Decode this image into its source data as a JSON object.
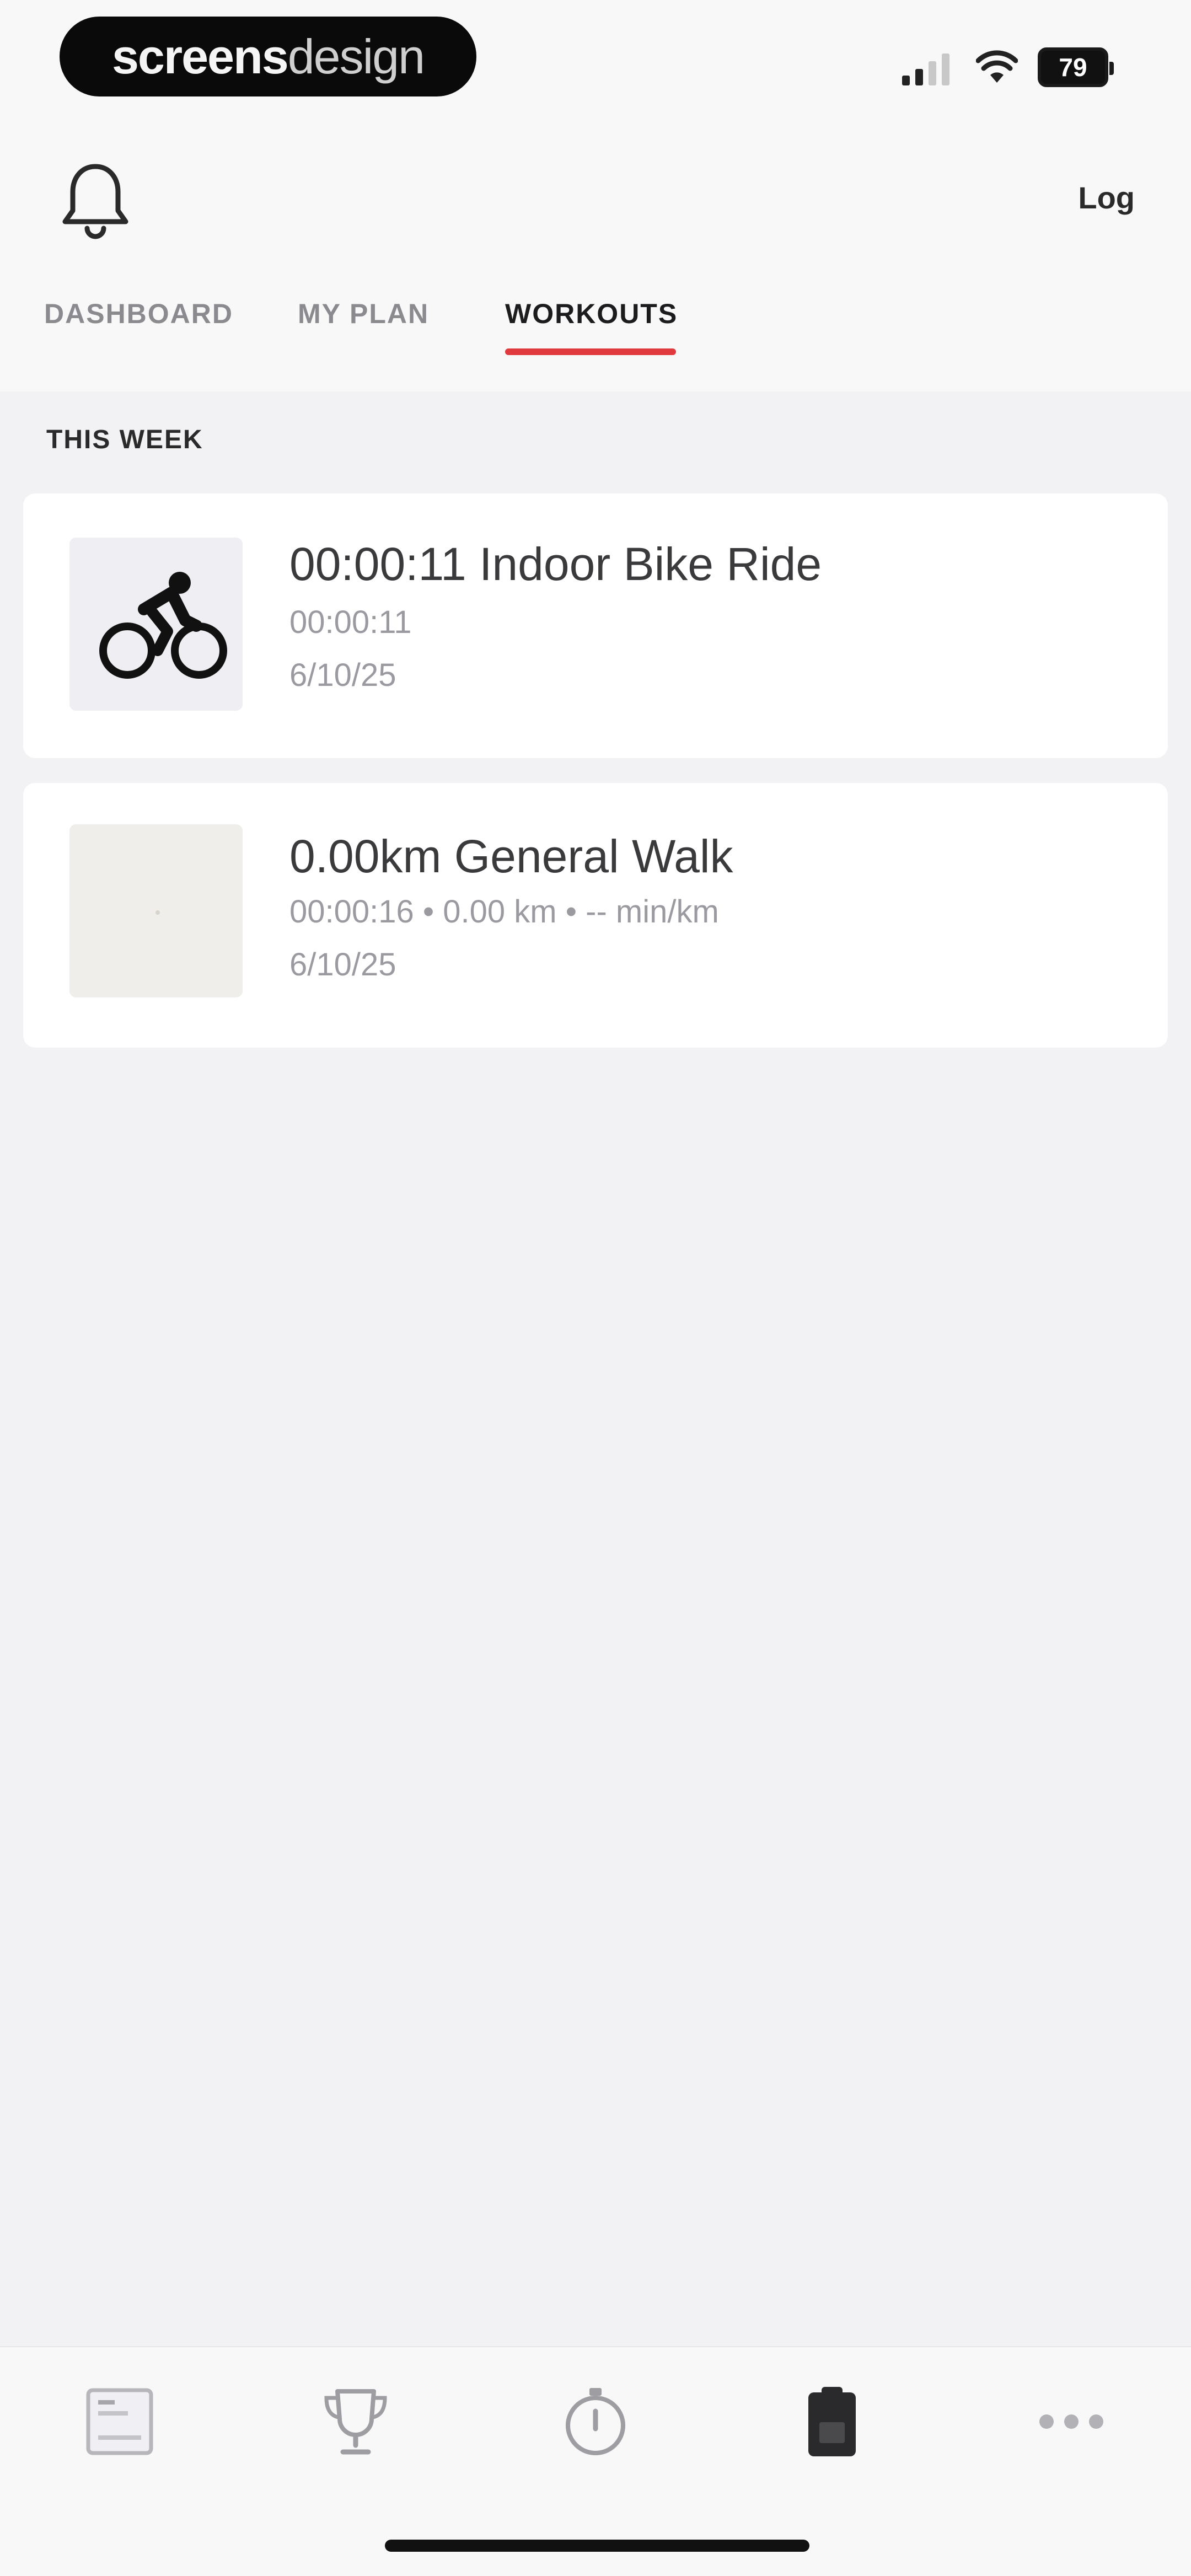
{
  "status_bar": {
    "brand_bold": "screens",
    "brand_light": "design",
    "battery": "79"
  },
  "header": {
    "log_label": "Log"
  },
  "tabs": [
    {
      "label": "DASHBOARD",
      "active": false
    },
    {
      "label": "MY PLAN",
      "active": false
    },
    {
      "label": "WORKOUTS",
      "active": true
    }
  ],
  "section_label": "THIS WEEK",
  "workouts": [
    {
      "title": "00:00:11 Indoor Bike Ride",
      "detail": "00:00:11",
      "date": "6/10/25",
      "icon": "bike-icon"
    },
    {
      "title": "0.00km General Walk",
      "detail": "00:00:16 • 0.00 km • -- min/km",
      "date": "6/10/25",
      "icon": "map-thumbnail"
    }
  ],
  "bottom_tabs": [
    {
      "name": "feed-icon",
      "active": false
    },
    {
      "name": "trophy-icon",
      "active": false
    },
    {
      "name": "stopwatch-icon",
      "active": false
    },
    {
      "name": "clipboard-icon",
      "active": true
    },
    {
      "name": "more-icon",
      "active": false
    }
  ],
  "colors": {
    "accent": "#e03a3e",
    "background": "#f2f1f4",
    "card": "#ffffff",
    "text_primary": "#3a3a3c",
    "text_secondary": "#9a9aa0"
  }
}
